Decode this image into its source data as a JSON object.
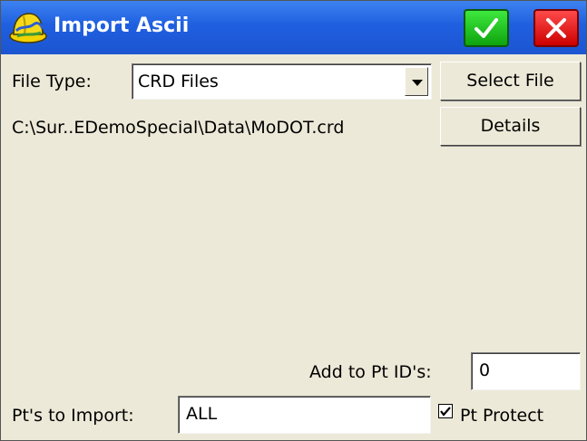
{
  "window": {
    "title": "Import Ascii",
    "icon": "hardhat-app-icon"
  },
  "titlebar": {
    "ok_icon": "checkmark-icon",
    "close_icon": "close-icon",
    "ok_color": "#1fc01f",
    "close_color": "#e31414"
  },
  "form": {
    "file_type_label": "File Type:",
    "file_type_value": "CRD Files",
    "select_file_label": "Select File",
    "file_path": "C:\\Sur..EDemoSpecial\\Data\\MoDOT.crd",
    "details_label": "Details",
    "add_to_ptid_label": "Add to Pt ID's:",
    "add_to_ptid_value": "0",
    "pts_to_import_label": "Pt's to Import:",
    "pts_to_import_value": "ALL",
    "pt_protect_label": "Pt Protect",
    "pt_protect_checked": true
  }
}
